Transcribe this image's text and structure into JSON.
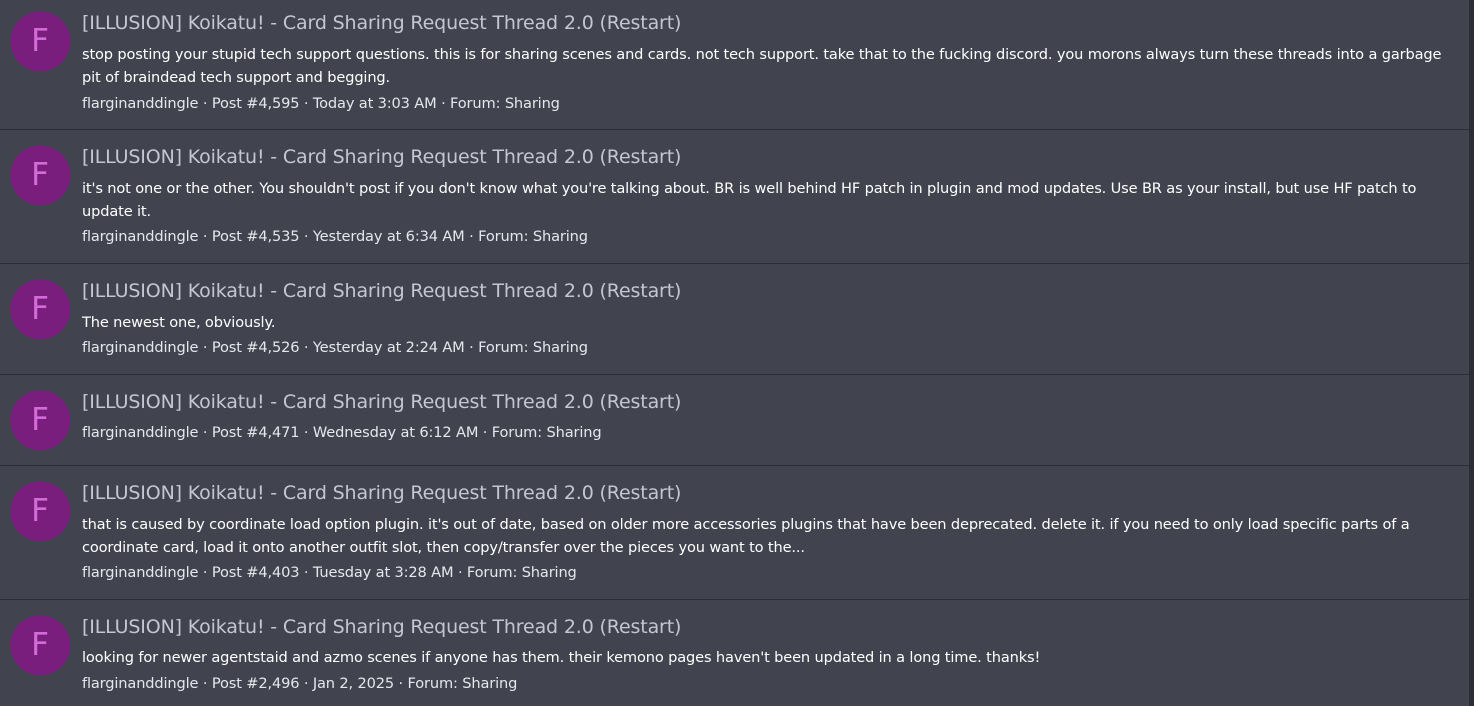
{
  "results": [
    {
      "avatar_letter": "F",
      "title": "[ILLUSION] Koikatu! - Card Sharing Request Thread 2.0 (Restart)",
      "snippet": "stop posting your stupid tech support questions. this is for sharing scenes and cards. not tech support. take that to the fucking discord. you morons always turn these threads into a garbage pit of braindead tech support and begging.",
      "author": "flarginanddingle",
      "post": "Post #4,595",
      "date": "Today at 3:03 AM",
      "forum": "Forum: Sharing"
    },
    {
      "avatar_letter": "F",
      "title": "[ILLUSION] Koikatu! - Card Sharing Request Thread 2.0 (Restart)",
      "snippet": "it's not one or the other. You shouldn't post if you don't know what you're talking about. BR is well behind HF patch in plugin and mod updates. Use BR as your install, but use HF patch to update it.",
      "author": "flarginanddingle",
      "post": "Post #4,535",
      "date": "Yesterday at 6:34 AM",
      "forum": "Forum: Sharing"
    },
    {
      "avatar_letter": "F",
      "title": "[ILLUSION] Koikatu! - Card Sharing Request Thread 2.0 (Restart)",
      "snippet": "The newest one, obviously.",
      "author": "flarginanddingle",
      "post": "Post #4,526",
      "date": "Yesterday at 2:24 AM",
      "forum": "Forum: Sharing"
    },
    {
      "avatar_letter": "F",
      "title": "[ILLUSION] Koikatu! - Card Sharing Request Thread 2.0 (Restart)",
      "snippet": "",
      "author": "flarginanddingle",
      "post": "Post #4,471",
      "date": "Wednesday at 6:12 AM",
      "forum": "Forum: Sharing"
    },
    {
      "avatar_letter": "F",
      "title": "[ILLUSION] Koikatu! - Card Sharing Request Thread 2.0 (Restart)",
      "snippet": "that is caused by coordinate load option plugin. it's out of date, based on older more accessories plugins that have been deprecated. delete it. if you need to only load specific parts of a coordinate card, load it onto another outfit slot, then copy/transfer over the pieces you want to the...",
      "author": "flarginanddingle",
      "post": "Post #4,403",
      "date": "Tuesday at 3:28 AM",
      "forum": "Forum: Sharing"
    },
    {
      "avatar_letter": "F",
      "title": "[ILLUSION] Koikatu! - Card Sharing Request Thread 2.0 (Restart)",
      "snippet": "looking for newer agentstaid and azmo scenes if anyone has them. their kemono pages haven't been updated in a long time. thanks!",
      "author": "flarginanddingle",
      "post": "Post #2,496",
      "date": "Jan 2, 2025",
      "forum": "Forum: Sharing"
    }
  ],
  "meta_separator": " · ",
  "colors": {
    "background": "#41434f",
    "avatar_bg": "#7a1e7e",
    "avatar_text": "#d36bd8",
    "title_text": "#c4c7d2",
    "divider": "#2c2e37"
  }
}
